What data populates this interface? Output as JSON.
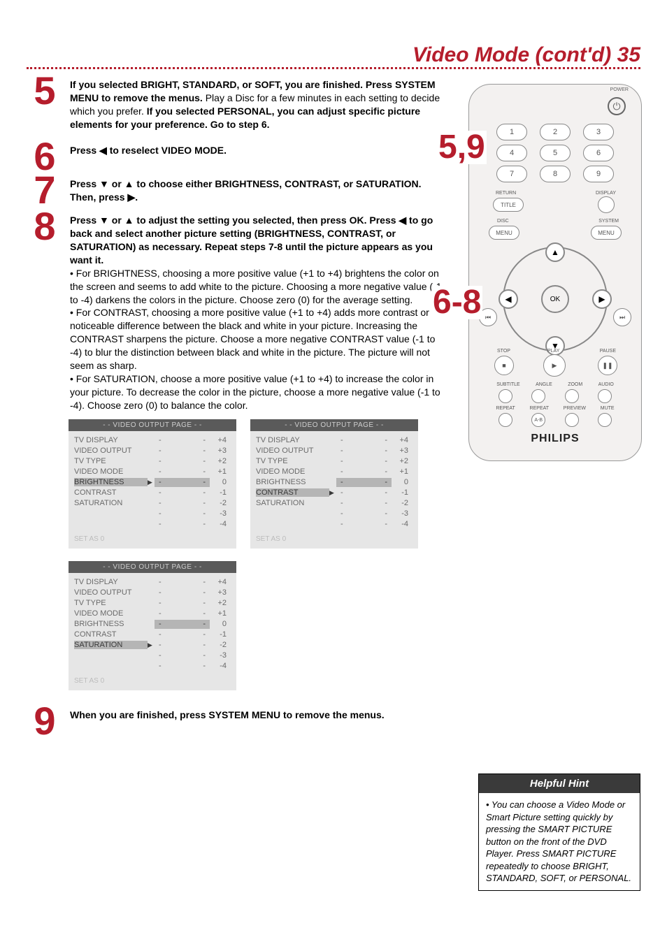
{
  "page": {
    "title": "Video Mode (cont'd)  35"
  },
  "steps": {
    "s5": {
      "num": "5",
      "l1a": "If you selected BRIGHT, STANDARD, or SOFT, you are finished. Press SYSTEM MENU to remove the menus.",
      "l1b": " Play a Disc for a few minutes in each setting to decide which you prefer. ",
      "l2": "If you selected PERSONAL, you can adjust specific picture elements for your preference. Go to step 6."
    },
    "s6": {
      "num": "6",
      "text": "Press ◀ to reselect VIDEO MODE."
    },
    "s7": {
      "num": "7",
      "text": "Press ▼ or ▲ to choose either BRIGHTNESS, CONTRAST, or SATURATION. Then, press ▶."
    },
    "s8": {
      "num": "8",
      "bold": "Press ▼ or ▲ to adjust the setting you selected, then press OK. Press ◀ to go back and select another picture setting (BRIGHTNESS, CONTRAST, or SATURATION) as necessary. Repeat steps 7-8 until the picture appears as you want it.",
      "p1": "• For BRIGHTNESS, choosing a more positive value (+1 to +4) brightens the color on the screen and seems to add white to the picture. Choosing a more negative value (-1 to -4) darkens the colors in the picture. Choose zero (0) for the average setting.",
      "p2": "• For CONTRAST, choosing a more positive value (+1 to +4) adds more contrast or noticeable difference between the black and white in your picture. Increasing the CONTRAST sharpens the picture. Choose a more negative CONTRAST value (-1 to -4) to blur the distinction between black and white in the picture. The picture will not seem as sharp.",
      "p3": "• For SATURATION, choose a more positive value (+1 to +4) to increase the color in your picture. To decrease the color in the picture, choose a more negative value (-1 to -4). Choose zero (0) to balance the color."
    },
    "s9": {
      "num": "9",
      "text": "When you are finished, press SYSTEM MENU to remove the menus."
    }
  },
  "osd": {
    "header": "- -   VIDEO OUTPUT PAGE   - -",
    "footer": "SET AS 0",
    "labels": [
      "TV DISPLAY",
      "VIDEO OUTPUT",
      "TV TYPE",
      "VIDEO MODE",
      "BRIGHTNESS",
      "CONTRAST",
      "SATURATION",
      "",
      ""
    ],
    "values": [
      "+4",
      "+3",
      "+2",
      "+1",
      "0",
      "-1",
      "-2",
      "-3",
      "-4"
    ],
    "screens": [
      {
        "selectedLabelIndex": 4,
        "selectedValueIndex": 4
      },
      {
        "selectedLabelIndex": 5,
        "selectedValueIndex": 4
      },
      {
        "selectedLabelIndex": 6,
        "selectedValueIndex": 4
      }
    ]
  },
  "remote": {
    "power": "⏻",
    "powerLabel": "POWER",
    "num": [
      "1",
      "2",
      "3",
      "4",
      "5",
      "6",
      "7",
      "8",
      "9"
    ],
    "returnTitle": "RETURN",
    "title": "TITLE",
    "display": "DISPLAY",
    "disc": "DISC",
    "discMenu": "MENU",
    "system": "SYSTEM",
    "systemMenu": "MENU",
    "ok": "OK",
    "prev": "⏮",
    "next": "⏭",
    "up": "▲",
    "down": "▼",
    "left": "◀",
    "right": "▶",
    "stop": "■",
    "play": "▶",
    "pause": "❚❚",
    "playLabel": "PLAY",
    "pauseLabel": "PAUSE",
    "stopLabel": "STOP",
    "row1": [
      "SUBTITLE",
      "ANGLE",
      "ZOOM",
      "AUDIO"
    ],
    "row2": [
      "REPEAT",
      "REPEAT",
      "PREVIEW",
      "MUTE"
    ],
    "ab": "A-B",
    "brand": "PHILIPS",
    "callout59": "5,9",
    "callout68": "6-8"
  },
  "hint": {
    "title": "Helpful Hint",
    "body": "•  You can choose a Video Mode or Smart Picture setting quickly by pressing the SMART PICTURE button on the front of the DVD Player. Press SMART PICTURE repeatedly to choose BRIGHT, STANDARD, SOFT, or PERSONAL."
  }
}
